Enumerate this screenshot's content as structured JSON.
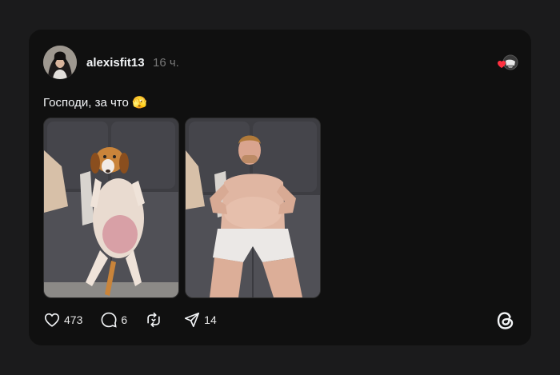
{
  "post": {
    "username": "alexisfit13",
    "time": "16 ч.",
    "text": "Господи, за что 🫣",
    "stats": {
      "likes": "473",
      "replies": "6",
      "reposts": "",
      "shares": "14"
    }
  },
  "icons": {
    "reaction": "heart-reaction-avatar-icon",
    "like": "heart-icon",
    "reply": "comment-bubble-icon",
    "repost": "repost-icon",
    "share": "send-arrow-icon",
    "brand": "threads-logo-icon"
  },
  "colors": {
    "background": "#1b1b1c",
    "card": "#101010",
    "text": "#f3f5f7",
    "muted": "#777777",
    "heart": "#ff3040"
  }
}
